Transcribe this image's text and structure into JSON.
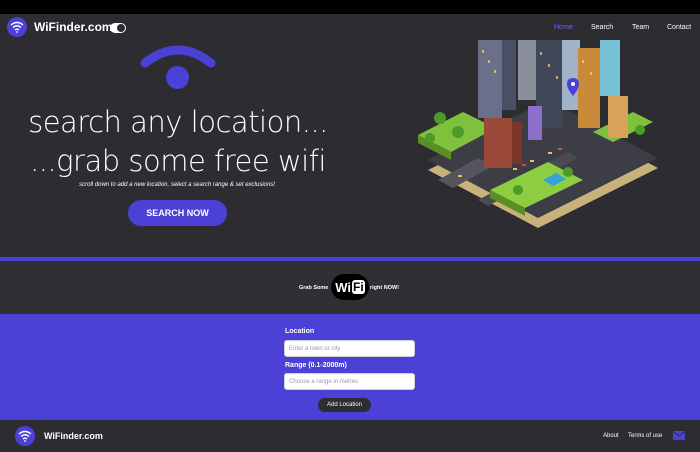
{
  "header": {
    "brand": "WiFinder.com",
    "nav": [
      {
        "label": "Home",
        "active": true
      },
      {
        "label": "Search"
      },
      {
        "label": "Team"
      },
      {
        "label": "Contact"
      }
    ]
  },
  "hero": {
    "headline1": "search any location...",
    "headline2": "...grab some free wifi",
    "subline": "scroll down to add a new location, select a search range & set exclusions!",
    "cta": "SEARCH NOW"
  },
  "banner": {
    "left": "Grab Some",
    "logo_wi": "Wi",
    "logo_fi": "Fi",
    "right": "right NOW!"
  },
  "form": {
    "location_label": "Location",
    "location_placeholder": "Enter a town or city",
    "range_label": "Range (0.1-2000m)",
    "range_placeholder": "Choose a range in metres",
    "submit": "Add Location"
  },
  "footer": {
    "brand": "WiFinder.com",
    "links": [
      "About",
      "Terms of use"
    ]
  },
  "icons": {
    "logo": "wifi-icon",
    "theme_toggle": "toggle-switch-icon",
    "mail": "mail-icon"
  },
  "colors": {
    "accent": "#4b41d6",
    "dark_bg": "#2c2c31",
    "nav_active": "#6e63ff"
  }
}
